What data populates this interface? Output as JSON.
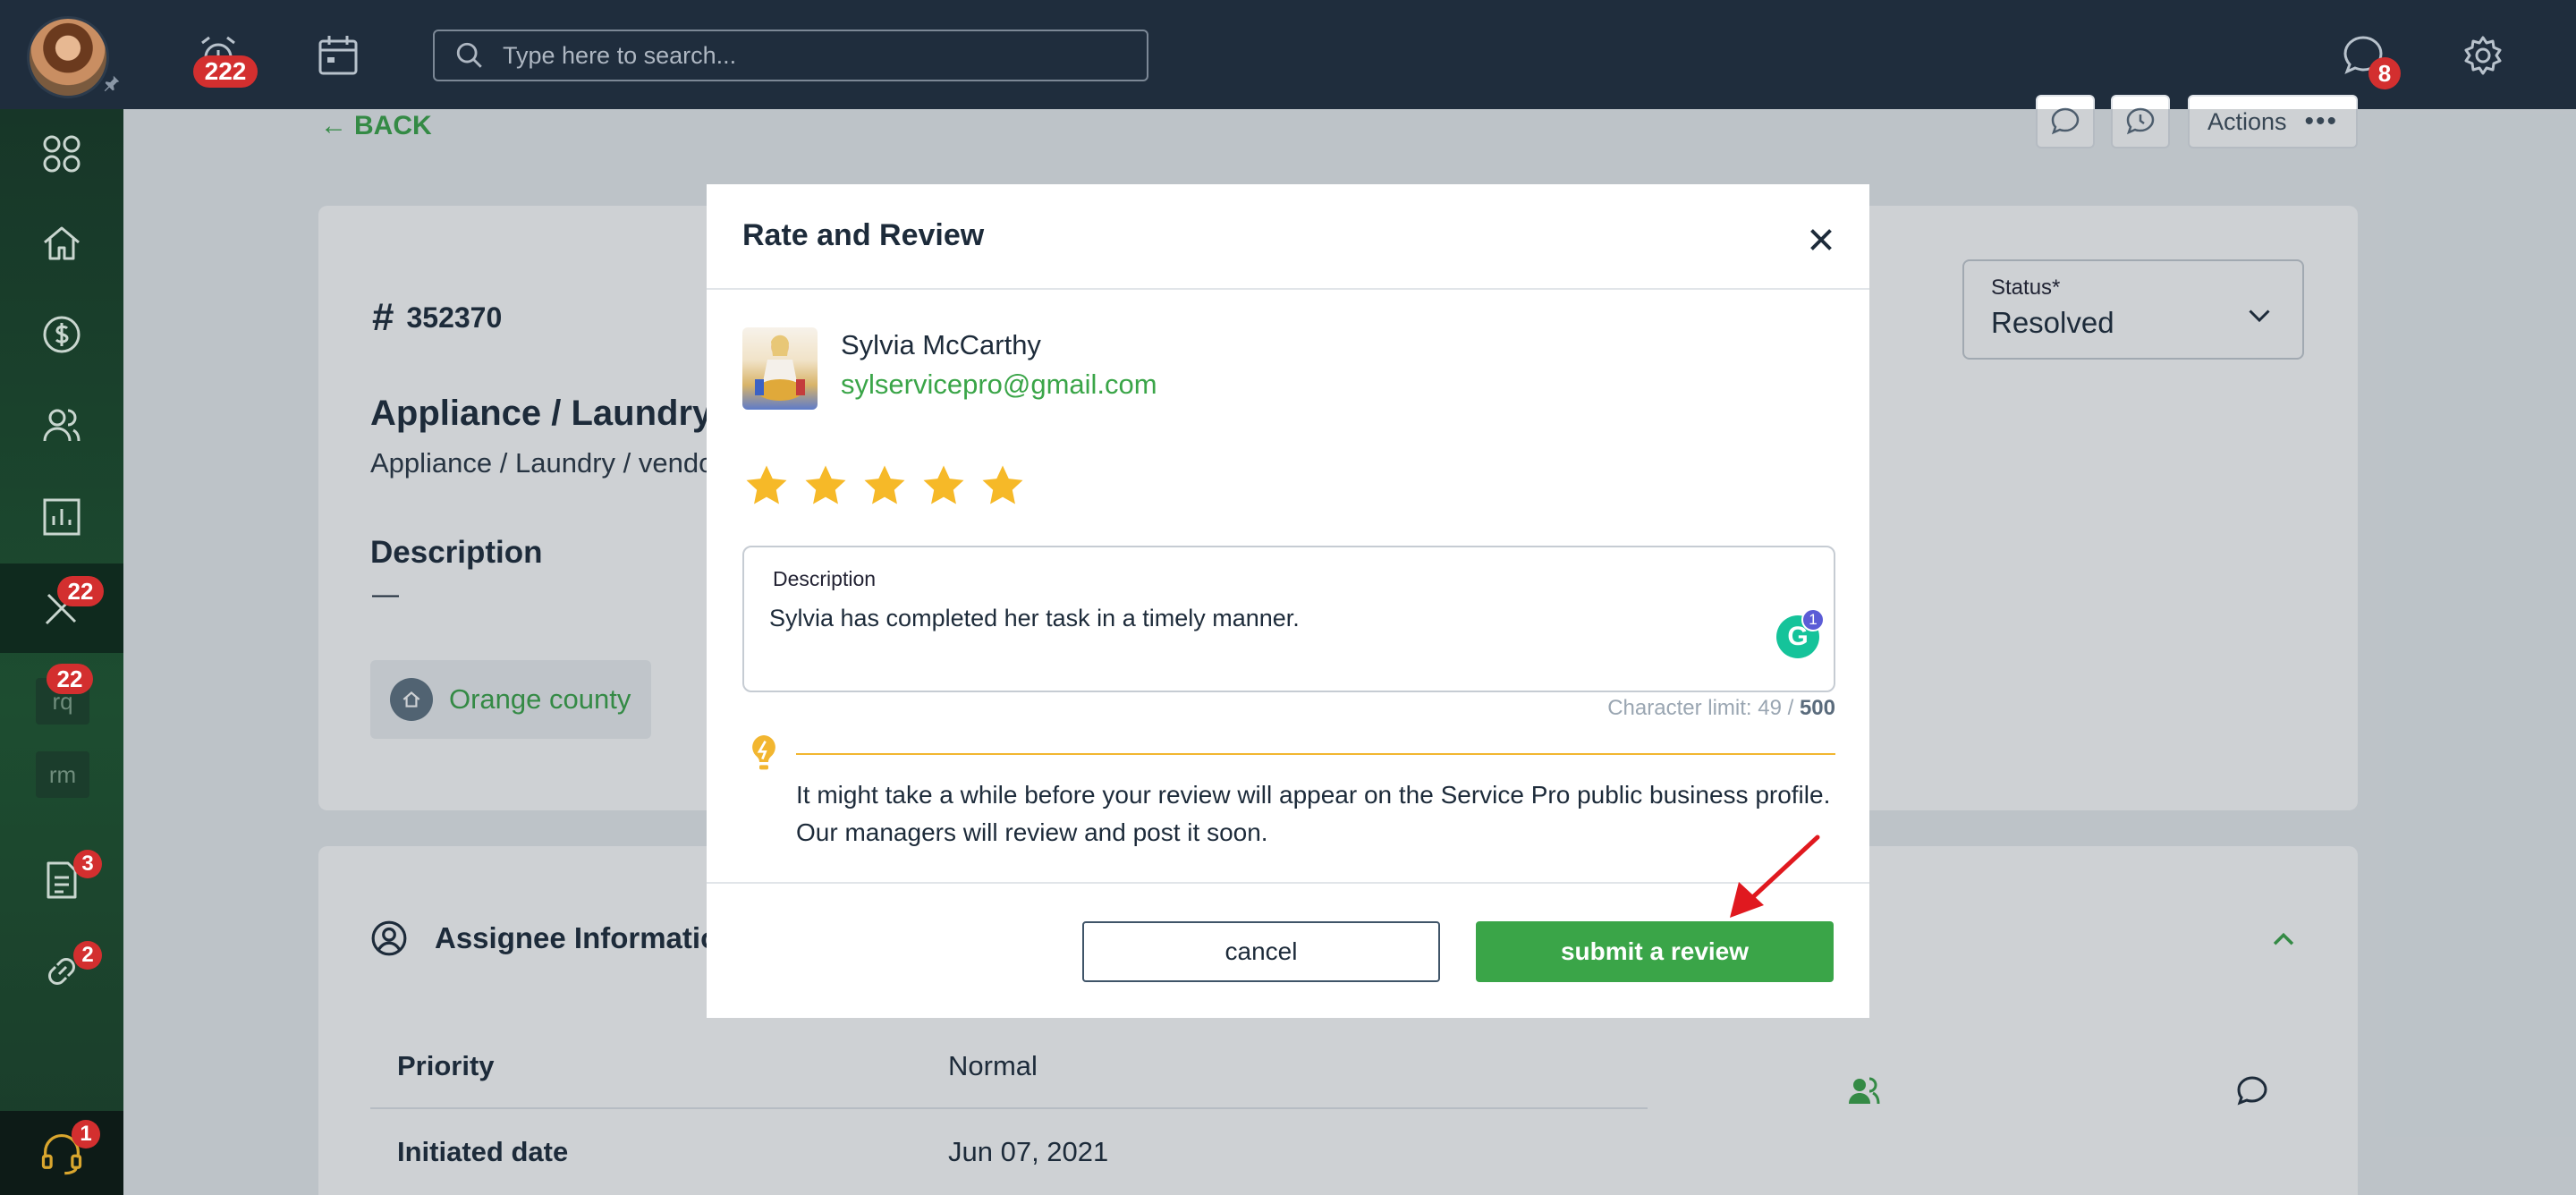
{
  "topbar": {
    "alarm_count": "222",
    "search_placeholder": "Type here to search...",
    "chat_count": "8"
  },
  "sidebar": {
    "items": [
      {
        "icon": "apps-icon"
      },
      {
        "icon": "home-icon"
      },
      {
        "icon": "dollar-icon"
      },
      {
        "icon": "users-icon"
      },
      {
        "icon": "chart-icon"
      },
      {
        "icon": "tools-icon",
        "badge": "22"
      },
      {
        "label": "rq",
        "badge": "22"
      },
      {
        "label": "rm"
      },
      {
        "icon": "document-icon",
        "badge": "3"
      },
      {
        "icon": "link-icon",
        "badge": "2"
      }
    ],
    "support_badge": "1"
  },
  "page": {
    "back_label": "BACK",
    "actions_label": "Actions",
    "ticket_number": "352370",
    "ticket_title": "Appliance / Laundry/V",
    "ticket_subtitle": "Appliance / Laundry / vendo",
    "description_heading": "Description",
    "description_value": "—",
    "location_chip": "Orange county",
    "status_label": "Status*",
    "status_value": "Resolved",
    "assignee_heading": "Assignee Informatio",
    "rows": [
      {
        "label": "Priority",
        "value": "Normal"
      },
      {
        "label": "Initiated date",
        "value": "Jun 07, 2021"
      }
    ]
  },
  "modal": {
    "title": "Rate and Review",
    "pro_name": "Sylvia McCarthy",
    "pro_email": "sylservicepro@gmail.com",
    "rating": 5,
    "rating_max": 5,
    "description_label": "Description",
    "description_value": "Sylvia has completed her task in a timely manner.",
    "grammarly_count": "1",
    "char_limit_prefix": "Character limit: 49 /",
    "char_limit_max": "500",
    "notice_line1": "It might take a while before your review will appear on the Service Pro public business profile.",
    "notice_line2": "Our managers will review and post it soon.",
    "cancel_label": "cancel",
    "submit_label": "submit a review"
  },
  "colors": {
    "accent_green": "#3aa548",
    "topbar": "#1f2d3d",
    "badge_red": "#d32f2f",
    "star": "#f6b928",
    "notice_line": "#f2b630",
    "annotation_arrow": "#e0191f"
  }
}
